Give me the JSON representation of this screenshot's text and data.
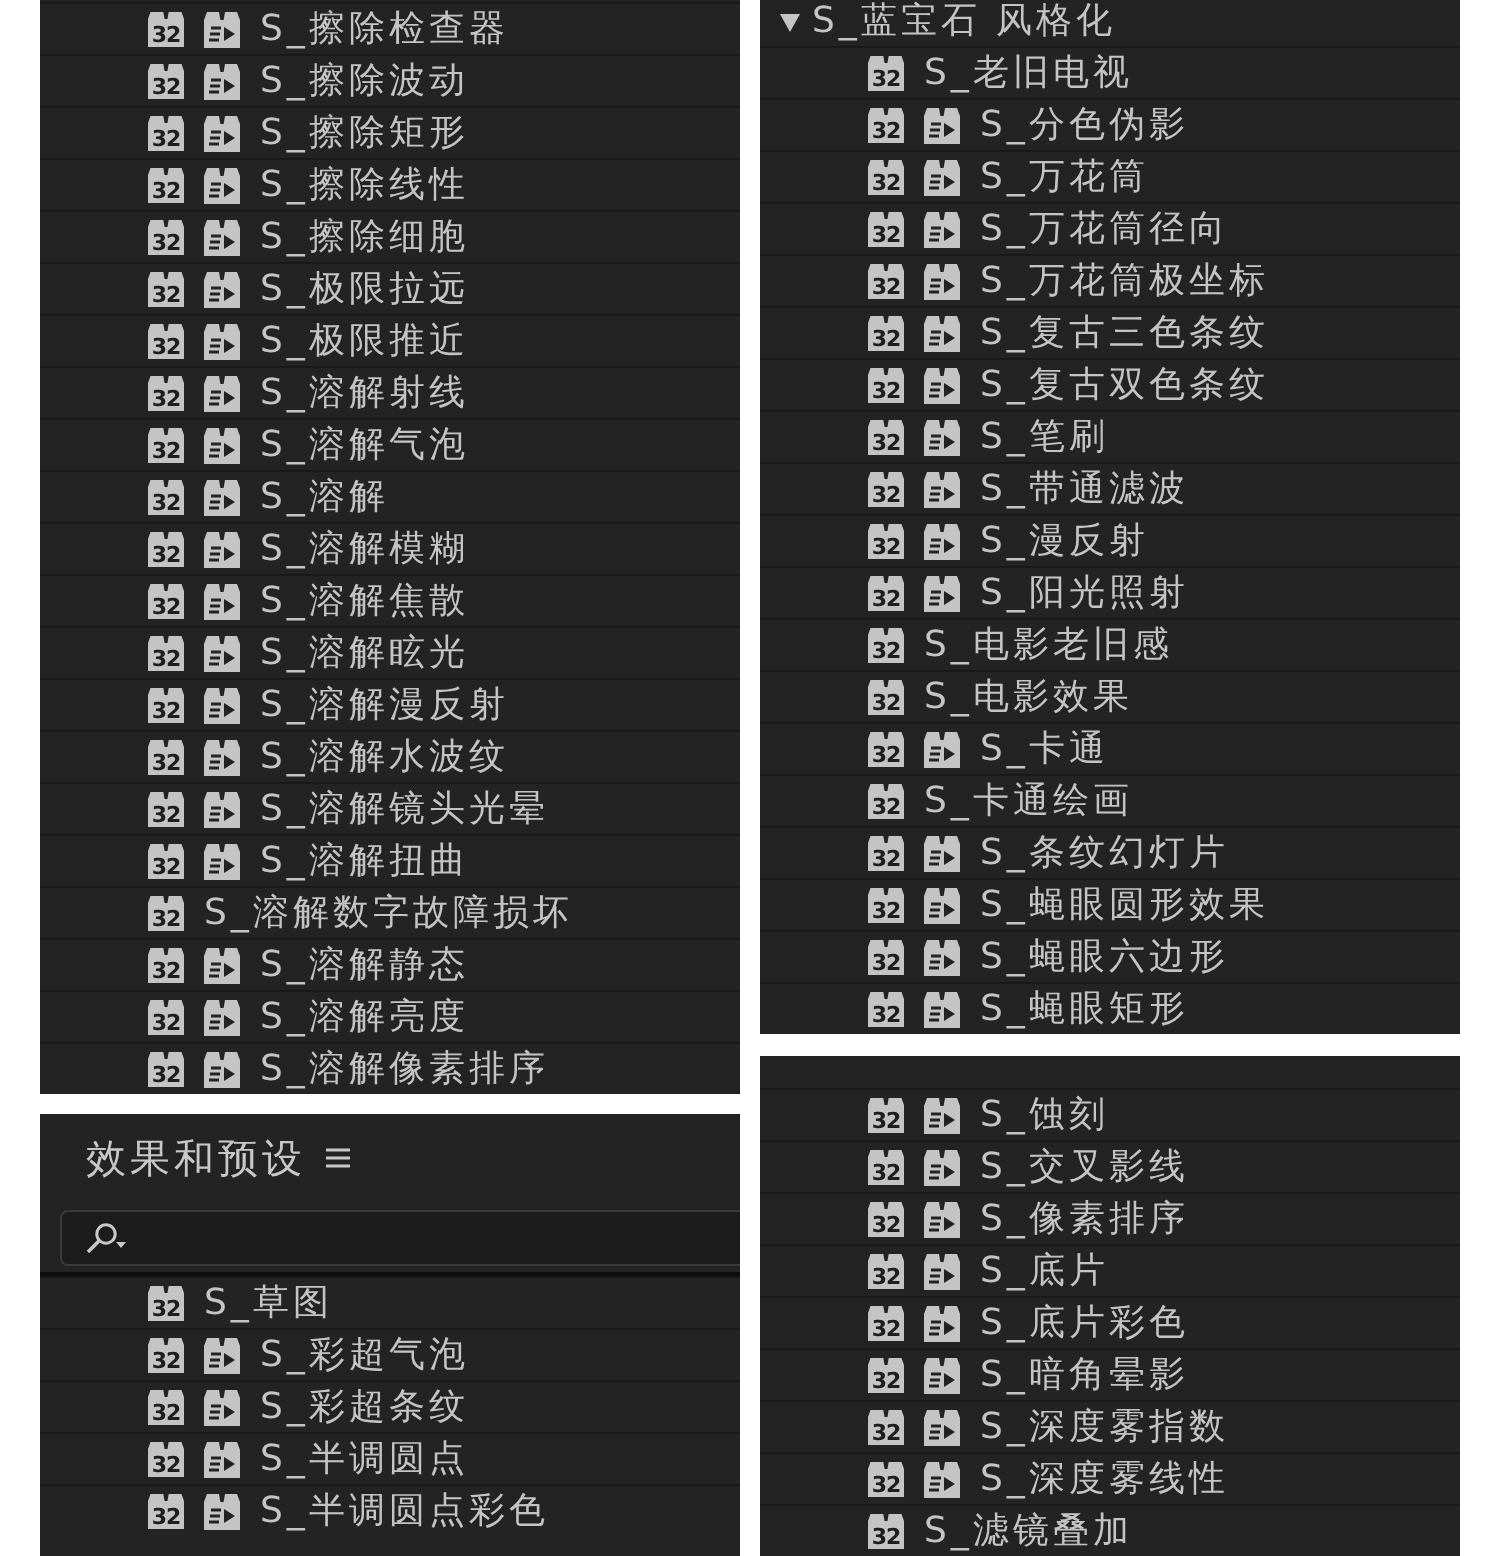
{
  "panels": [
    {
      "kind": "list",
      "rows": [
        {
          "kind": "effect",
          "label": "S_擦除检查器",
          "bit_depth": "32",
          "gpu": true
        },
        {
          "kind": "effect",
          "label": "S_擦除波动",
          "bit_depth": "32",
          "gpu": true
        },
        {
          "kind": "effect",
          "label": "S_擦除矩形",
          "bit_depth": "32",
          "gpu": true
        },
        {
          "kind": "effect",
          "label": "S_擦除线性",
          "bit_depth": "32",
          "gpu": true
        },
        {
          "kind": "effect",
          "label": "S_擦除细胞",
          "bit_depth": "32",
          "gpu": true
        },
        {
          "kind": "effect",
          "label": "S_极限拉远",
          "bit_depth": "32",
          "gpu": true
        },
        {
          "kind": "effect",
          "label": "S_极限推近",
          "bit_depth": "32",
          "gpu": true
        },
        {
          "kind": "effect",
          "label": "S_溶解射线",
          "bit_depth": "32",
          "gpu": true
        },
        {
          "kind": "effect",
          "label": "S_溶解气泡",
          "bit_depth": "32",
          "gpu": true
        },
        {
          "kind": "effect",
          "label": "S_溶解",
          "bit_depth": "32",
          "gpu": true
        },
        {
          "kind": "effect",
          "label": "S_溶解模糊",
          "bit_depth": "32",
          "gpu": true
        },
        {
          "kind": "effect",
          "label": "S_溶解焦散",
          "bit_depth": "32",
          "gpu": true
        },
        {
          "kind": "effect",
          "label": "S_溶解眩光",
          "bit_depth": "32",
          "gpu": true
        },
        {
          "kind": "effect",
          "label": "S_溶解漫反射",
          "bit_depth": "32",
          "gpu": true
        },
        {
          "kind": "effect",
          "label": "S_溶解水波纹",
          "bit_depth": "32",
          "gpu": true
        },
        {
          "kind": "effect",
          "label": "S_溶解镜头光晕",
          "bit_depth": "32",
          "gpu": true
        },
        {
          "kind": "effect",
          "label": "S_溶解扭曲",
          "bit_depth": "32",
          "gpu": true
        },
        {
          "kind": "effect",
          "label": "S_溶解数字故障损坏",
          "bit_depth": "32",
          "gpu": false
        },
        {
          "kind": "effect",
          "label": "S_溶解静态",
          "bit_depth": "32",
          "gpu": true
        },
        {
          "kind": "effect",
          "label": "S_溶解亮度",
          "bit_depth": "32",
          "gpu": true
        },
        {
          "kind": "effect",
          "label": "S_溶解像素排序",
          "bit_depth": "32",
          "gpu": true
        }
      ]
    },
    {
      "kind": "browser",
      "title": "效果和预设",
      "rows": [
        {
          "kind": "effect",
          "label": "S_草图",
          "bit_depth": "32",
          "gpu": false
        },
        {
          "kind": "effect",
          "label": "S_彩超气泡",
          "bit_depth": "32",
          "gpu": true
        },
        {
          "kind": "effect",
          "label": "S_彩超条纹",
          "bit_depth": "32",
          "gpu": true
        },
        {
          "kind": "effect",
          "label": "S_半调圆点",
          "bit_depth": "32",
          "gpu": true
        },
        {
          "kind": "effect",
          "label": "S_半调圆点彩色",
          "bit_depth": "32",
          "gpu": true
        }
      ]
    },
    {
      "kind": "list",
      "rows": [
        {
          "kind": "folder",
          "label": "S_蓝宝石 风格化",
          "expanded": true,
          "children": [
            {
              "kind": "effect",
              "label": "S_老旧电视",
              "bit_depth": "32",
              "gpu": false
            },
            {
              "kind": "effect",
              "label": "S_分色伪影",
              "bit_depth": "32",
              "gpu": true
            },
            {
              "kind": "effect",
              "label": "S_万花筒",
              "bit_depth": "32",
              "gpu": true
            },
            {
              "kind": "effect",
              "label": "S_万花筒径向",
              "bit_depth": "32",
              "gpu": true
            },
            {
              "kind": "effect",
              "label": "S_万花筒极坐标",
              "bit_depth": "32",
              "gpu": true
            },
            {
              "kind": "effect",
              "label": "S_复古三色条纹",
              "bit_depth": "32",
              "gpu": true
            },
            {
              "kind": "effect",
              "label": "S_复古双色条纹",
              "bit_depth": "32",
              "gpu": true
            },
            {
              "kind": "effect",
              "label": "S_笔刷",
              "bit_depth": "32",
              "gpu": true
            },
            {
              "kind": "effect",
              "label": "S_带通滤波",
              "bit_depth": "32",
              "gpu": true
            },
            {
              "kind": "effect",
              "label": "S_漫反射",
              "bit_depth": "32",
              "gpu": true
            },
            {
              "kind": "effect",
              "label": "S_阳光照射",
              "bit_depth": "32",
              "gpu": true
            },
            {
              "kind": "effect",
              "label": "S_电影老旧感",
              "bit_depth": "32",
              "gpu": false
            },
            {
              "kind": "effect",
              "label": "S_电影效果",
              "bit_depth": "32",
              "gpu": false
            },
            {
              "kind": "effect",
              "label": "S_卡通",
              "bit_depth": "32",
              "gpu": true
            },
            {
              "kind": "effect",
              "label": "S_卡通绘画",
              "bit_depth": "32",
              "gpu": false
            },
            {
              "kind": "effect",
              "label": "S_条纹幻灯片",
              "bit_depth": "32",
              "gpu": true
            },
            {
              "kind": "effect",
              "label": "S_蝇眼圆形效果",
              "bit_depth": "32",
              "gpu": true
            },
            {
              "kind": "effect",
              "label": "S_蝇眼六边形",
              "bit_depth": "32",
              "gpu": true
            },
            {
              "kind": "effect",
              "label": "S_蝇眼矩形",
              "bit_depth": "32",
              "gpu": true
            }
          ]
        }
      ]
    },
    {
      "kind": "list",
      "rows": [
        {
          "kind": "effect",
          "label": "S_蚀刻",
          "bit_depth": "32",
          "gpu": true
        },
        {
          "kind": "effect",
          "label": "S_交叉影线",
          "bit_depth": "32",
          "gpu": true
        },
        {
          "kind": "effect",
          "label": "S_像素排序",
          "bit_depth": "32",
          "gpu": true
        },
        {
          "kind": "effect",
          "label": "S_底片",
          "bit_depth": "32",
          "gpu": true
        },
        {
          "kind": "effect",
          "label": "S_底片彩色",
          "bit_depth": "32",
          "gpu": true
        },
        {
          "kind": "effect",
          "label": "S_暗角晕影",
          "bit_depth": "32",
          "gpu": true
        },
        {
          "kind": "effect",
          "label": "S_深度雾指数",
          "bit_depth": "32",
          "gpu": true
        },
        {
          "kind": "effect",
          "label": "S_深度雾线性",
          "bit_depth": "32",
          "gpu": true
        },
        {
          "kind": "effect",
          "label": "S_滤镜叠加",
          "bit_depth": "32",
          "gpu": false
        }
      ]
    }
  ]
}
